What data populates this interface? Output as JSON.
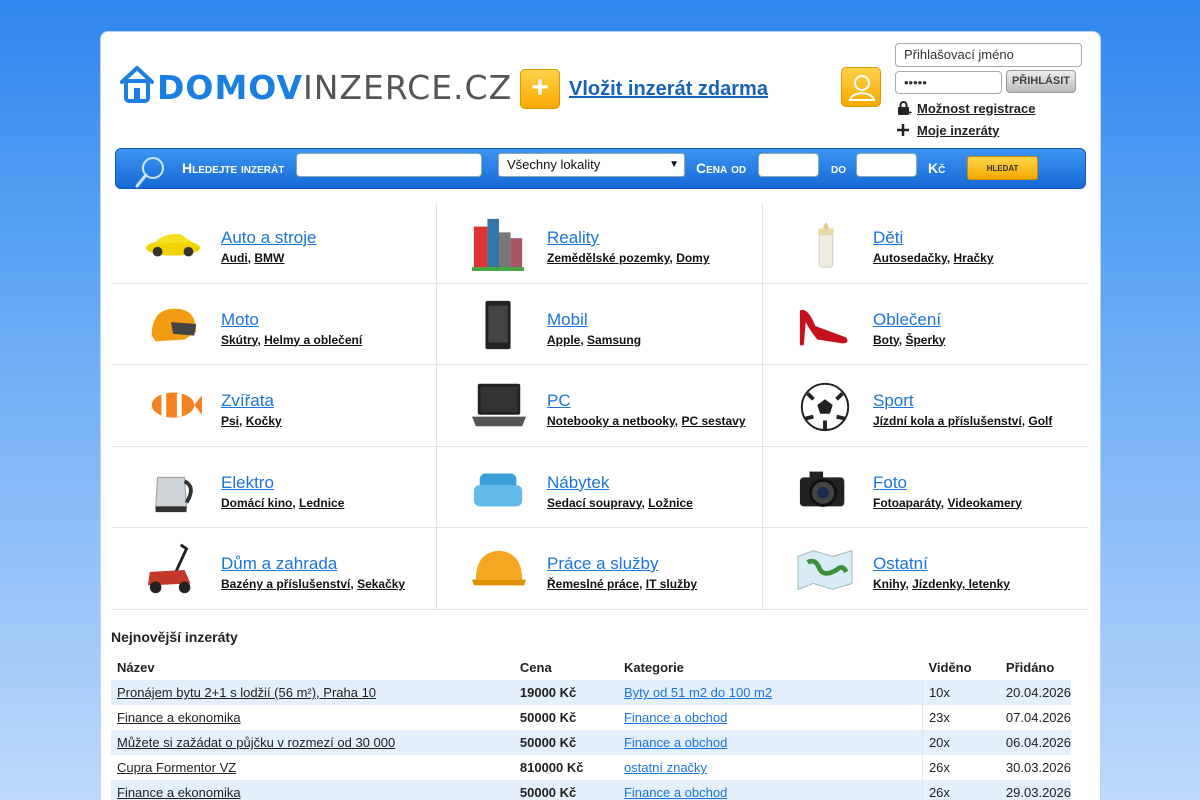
{
  "site": {
    "logo_bold": "DOMOV",
    "logo_rest": "INZERCE.CZ",
    "add_listing": "Vložit inzerát zdarma"
  },
  "login": {
    "username_placeholder": "Přihlašovací jméno",
    "password_value": "•••••",
    "login_button": "PŘIHLÁSIT",
    "register_link": "Možnost registrace",
    "my_listings_link": "Moje inzeráty"
  },
  "search": {
    "label": "Hledejte inzerát",
    "location_value": "Všechny lokality",
    "price_from_label": "Cena od",
    "price_to_label": "do",
    "currency": "Kč",
    "button": "hledat"
  },
  "categories": [
    {
      "title": "Auto a stroje",
      "icon": "car-icon",
      "subs": [
        "Audi",
        "BMW"
      ]
    },
    {
      "title": "Reality",
      "icon": "buildings-icon",
      "subs": [
        "Zemědělské pozemky",
        "Domy"
      ]
    },
    {
      "title": "Děti",
      "icon": "baby-bottle-icon",
      "subs": [
        "Autosedačky",
        "Hračky"
      ]
    },
    {
      "title": "Moto",
      "icon": "helmet-icon",
      "subs": [
        "Skútry",
        "Helmy a oblečení"
      ]
    },
    {
      "title": "Mobil",
      "icon": "phone-icon",
      "subs": [
        "Apple",
        "Samsung"
      ]
    },
    {
      "title": "Oblečení",
      "icon": "high-heel-icon",
      "subs": [
        "Boty",
        "Šperky"
      ]
    },
    {
      "title": "Zvířata",
      "icon": "clownfish-icon",
      "subs": [
        "Psi",
        "Kočky"
      ]
    },
    {
      "title": "PC",
      "icon": "laptop-icon",
      "subs": [
        "Notebooky a netbooky",
        "PC sestavy"
      ]
    },
    {
      "title": "Sport",
      "icon": "soccer-ball-icon",
      "subs": [
        "Jízdní kola a příslušenství",
        "Golf"
      ]
    },
    {
      "title": "Elektro",
      "icon": "kettle-icon",
      "subs": [
        "Domácí kino",
        "Lednice"
      ]
    },
    {
      "title": "Nábytek",
      "icon": "armchair-icon",
      "subs": [
        "Sedací soupravy",
        "Ložnice"
      ]
    },
    {
      "title": "Foto",
      "icon": "camera-icon",
      "subs": [
        "Fotoaparáty",
        "Videokamery"
      ]
    },
    {
      "title": "Dům a zahrada",
      "icon": "lawnmower-icon",
      "subs": [
        "Bazény a příslušenství",
        "Sekačky"
      ]
    },
    {
      "title": "Práce a služby",
      "icon": "hard-hat-icon",
      "subs": [
        "Řemeslné práce",
        "IT služby"
      ]
    },
    {
      "title": "Ostatní",
      "icon": "map-icon",
      "subs": [
        "Knihy",
        "Jízdenky, letenky"
      ]
    }
  ],
  "latest": {
    "title": "Nejnovější inzeráty",
    "columns": [
      "Název",
      "Cena",
      "Kategorie",
      "Viděno",
      "Přidáno"
    ],
    "rows": [
      {
        "name": "Pronájem bytu 2+1 s lodžií (56 m²), Praha 10",
        "price": "19000 Kč",
        "category": "Byty od 51 m2 do 100 m2",
        "views": "10x",
        "added": "20.04.2026"
      },
      {
        "name": "Finance a ekonomika",
        "price": "50000 Kč",
        "category": "Finance a obchod",
        "views": "23x",
        "added": "07.04.2026"
      },
      {
        "name": "Můžete si zažádat o půjčku v rozmezí od 30 000",
        "price": "50000 Kč",
        "category": "Finance a obchod",
        "views": "20x",
        "added": "06.04.2026"
      },
      {
        "name": "Cupra Formentor VZ",
        "price": "810000 Kč",
        "category": "ostatní značky",
        "views": "26x",
        "added": "30.03.2026"
      },
      {
        "name": "Finance a ekonomika",
        "price": "50000 Kč",
        "category": "Finance a obchod",
        "views": "26x",
        "added": "29.03.2026"
      }
    ]
  }
}
